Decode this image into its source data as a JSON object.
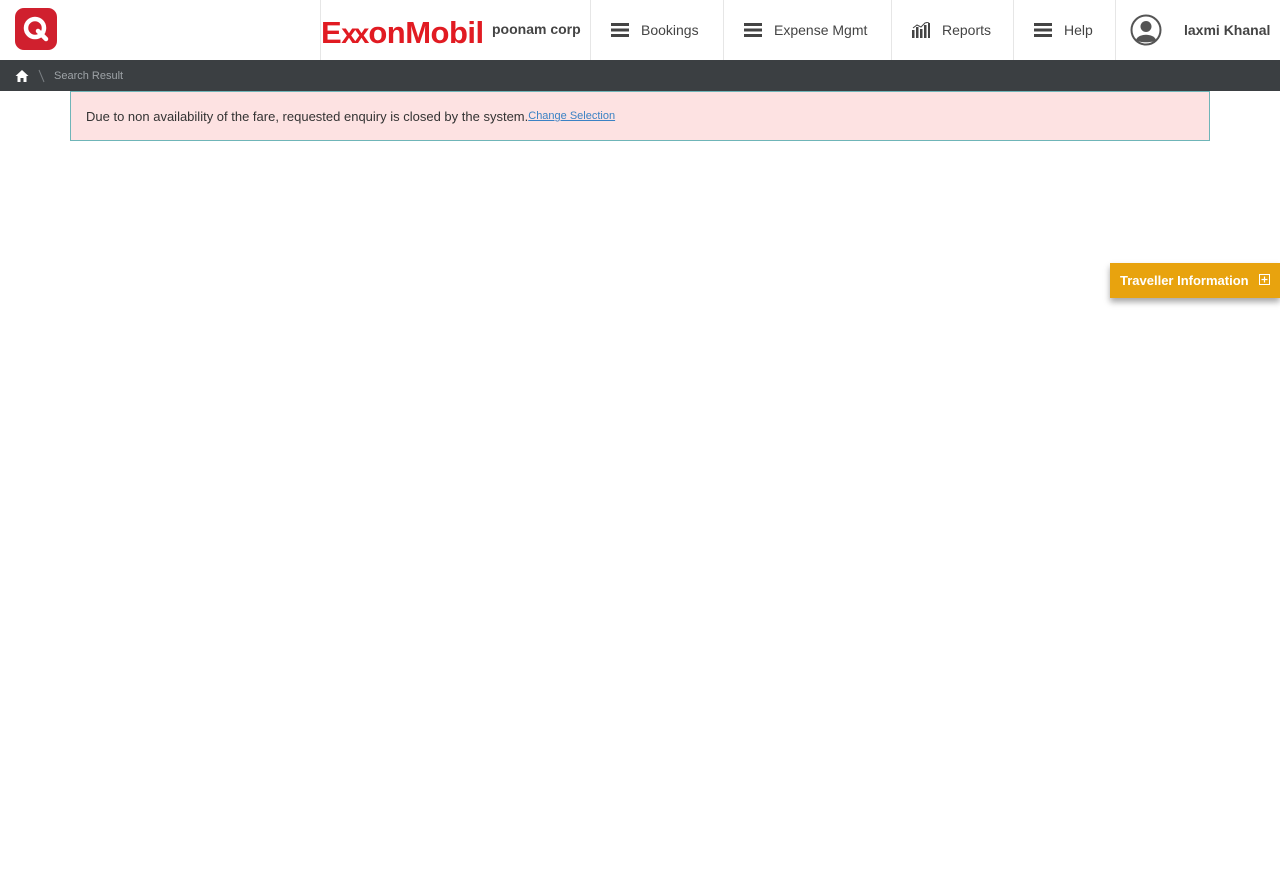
{
  "header": {
    "brand_logo_text_1": "E",
    "brand_logo_text_2": "xx",
    "brand_logo_text_3": "onMobil",
    "corp_name": "poonam corp",
    "nav": {
      "bookings": "Bookings",
      "expense": "Expense Mgmt",
      "reports": "Reports",
      "help": "Help"
    },
    "user_name": "laxmi Khanal"
  },
  "breadcrumb": {
    "current": "Search Result"
  },
  "alert": {
    "message": "Due to non availability of the fare, requested enquiry is closed by the system.",
    "link": "Change Selection"
  },
  "traveller_tab": {
    "label": "Traveller Information"
  },
  "colors": {
    "brand_red": "#e11b22",
    "app_logo_red": "#d0202e",
    "breadcrumb_bg": "#3b3f42",
    "alert_bg": "#fde2e2",
    "tab_orange": "#e8a30e"
  },
  "icons": {
    "app_logo": "q-logo-icon",
    "bookings": "menu-icon",
    "expense": "menu-icon",
    "reports": "bar-chart-icon",
    "help": "menu-icon",
    "user": "user-circle-icon",
    "home": "home-icon",
    "traveller_tab": "plus-square-icon"
  }
}
